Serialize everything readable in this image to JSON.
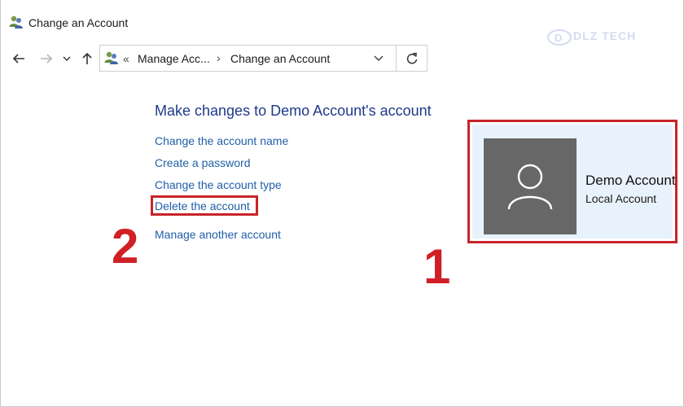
{
  "window": {
    "title": "Change an Account",
    "title_icon": "user-accounts-icon"
  },
  "watermark": {
    "text": "DLZ TECH"
  },
  "nav": {
    "back_icon": "arrow-left-icon",
    "forward_icon": "arrow-right-icon",
    "recent_icon": "chevron-down-icon",
    "up_icon": "arrow-up-icon"
  },
  "address": {
    "overflow": "«",
    "crumbs": [
      "Manage Acc...",
      "Change an Account"
    ],
    "separator": "›",
    "dropdown_icon": "chevron-down-icon",
    "refresh_icon": "refresh-icon"
  },
  "main": {
    "heading": "Make changes to Demo Account's account",
    "links": [
      "Change the account name",
      "Create a password",
      "Change the account type",
      "Delete the account",
      "Manage another account"
    ]
  },
  "account": {
    "name": "Demo Account",
    "type": "Local Account",
    "avatar_icon": "user-silhouette-icon"
  },
  "annotations": {
    "step_1": "1",
    "step_2": "2"
  },
  "colors": {
    "link": "#1f5fa8",
    "heading": "#1e3a8a",
    "highlight": "#c8242a",
    "annotation": "#d11f26",
    "avatar_bg": "#676767",
    "account_bg": "#e8f2fc"
  }
}
